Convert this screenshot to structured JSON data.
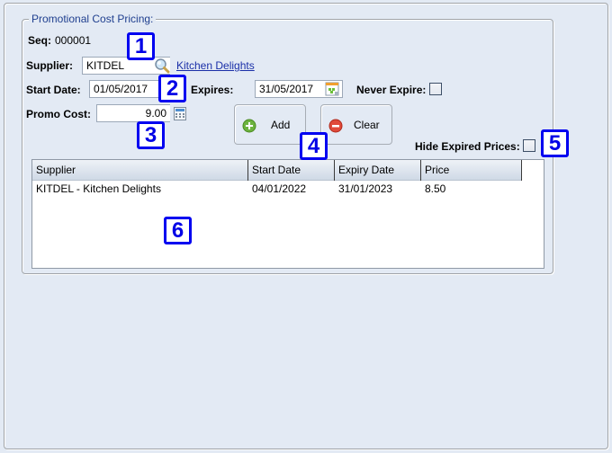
{
  "group": {
    "title": "Promotional Cost Pricing:"
  },
  "seq": {
    "label": "Seq:",
    "value": "000001"
  },
  "supplier": {
    "label": "Supplier:",
    "value": "KITDEL",
    "name_link": "Kitchen Delights",
    "lookup_icon": "magnifier-icon"
  },
  "start_date": {
    "label": "Start Date:",
    "value": "01/05/2017"
  },
  "expires": {
    "label": "Expires:",
    "value": "31/05/2017",
    "picker_icon": "calendar-icon"
  },
  "never_expire": {
    "label": "Never Expire:",
    "checked": false
  },
  "promo_cost": {
    "label": "Promo Cost:",
    "value": "9.00",
    "picker_icon": "calculator-icon"
  },
  "buttons": {
    "add": {
      "label": "Add",
      "icon": "plus-circle-icon",
      "color": "#5fa82a"
    },
    "clear": {
      "label": "Clear",
      "icon": "minus-circle-icon",
      "color": "#d93a2b"
    }
  },
  "hide_expired": {
    "label": "Hide Expired Prices:",
    "checked": false
  },
  "table": {
    "columns": [
      "Supplier",
      "Start Date",
      "Expiry Date",
      "Price"
    ],
    "rows": [
      [
        "KITDEL - Kitchen Delights",
        "04/01/2022",
        "31/01/2023",
        "8.50"
      ]
    ]
  },
  "callouts": [
    "1",
    "2",
    "3",
    "4",
    "5",
    "6"
  ],
  "colors": {
    "background": "#e3eaf4",
    "callout": "#0000f0",
    "link": "#1a2fa8"
  }
}
